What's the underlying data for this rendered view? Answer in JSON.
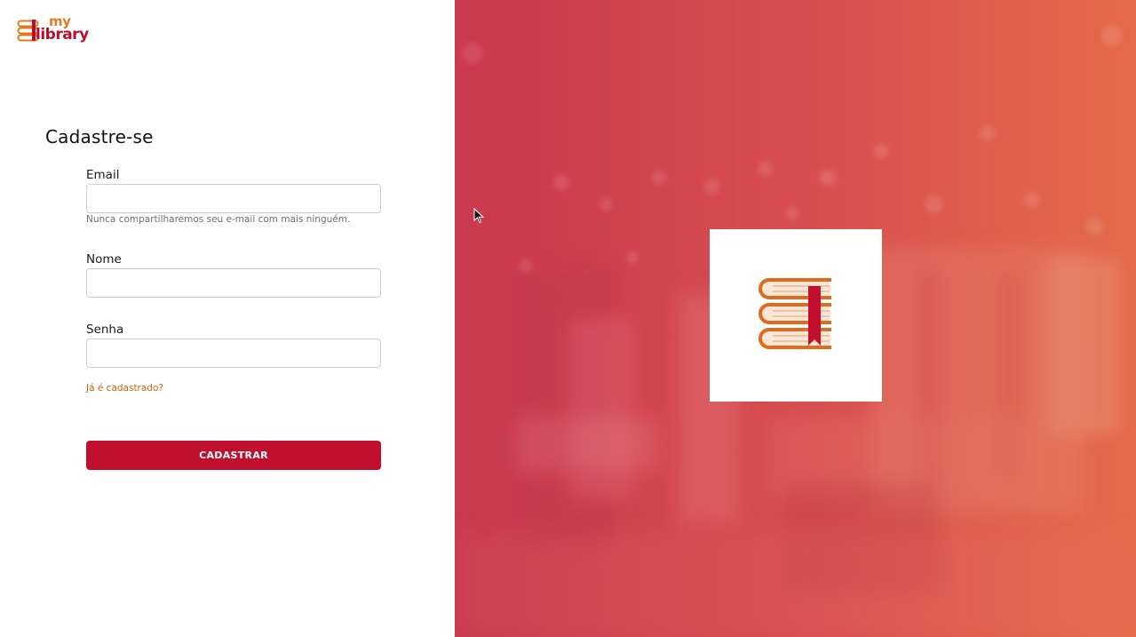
{
  "app": {
    "logo_top": "my",
    "logo_bottom": "library"
  },
  "form": {
    "title": "Cadastre-se",
    "email": {
      "label": "Email",
      "value": "",
      "help": "Nunca compartilharemos seu e-mail com mais ninguém."
    },
    "name": {
      "label": "Nome",
      "value": ""
    },
    "password": {
      "label": "Senha",
      "value": ""
    },
    "login_link": "Já é cadastrado?",
    "submit_label": "CADASTRAR"
  },
  "icons": {
    "logo": "books-logo-icon",
    "feature": "books-bookmark-icon",
    "cursor": "mouse-pointer-icon"
  },
  "colors": {
    "brand_red": "#c0102d",
    "brand_orange": "#e07a1f",
    "link_orange": "#c8640f",
    "panel_gradient_start": "#c93a4e",
    "panel_gradient_end": "#e0654a"
  }
}
